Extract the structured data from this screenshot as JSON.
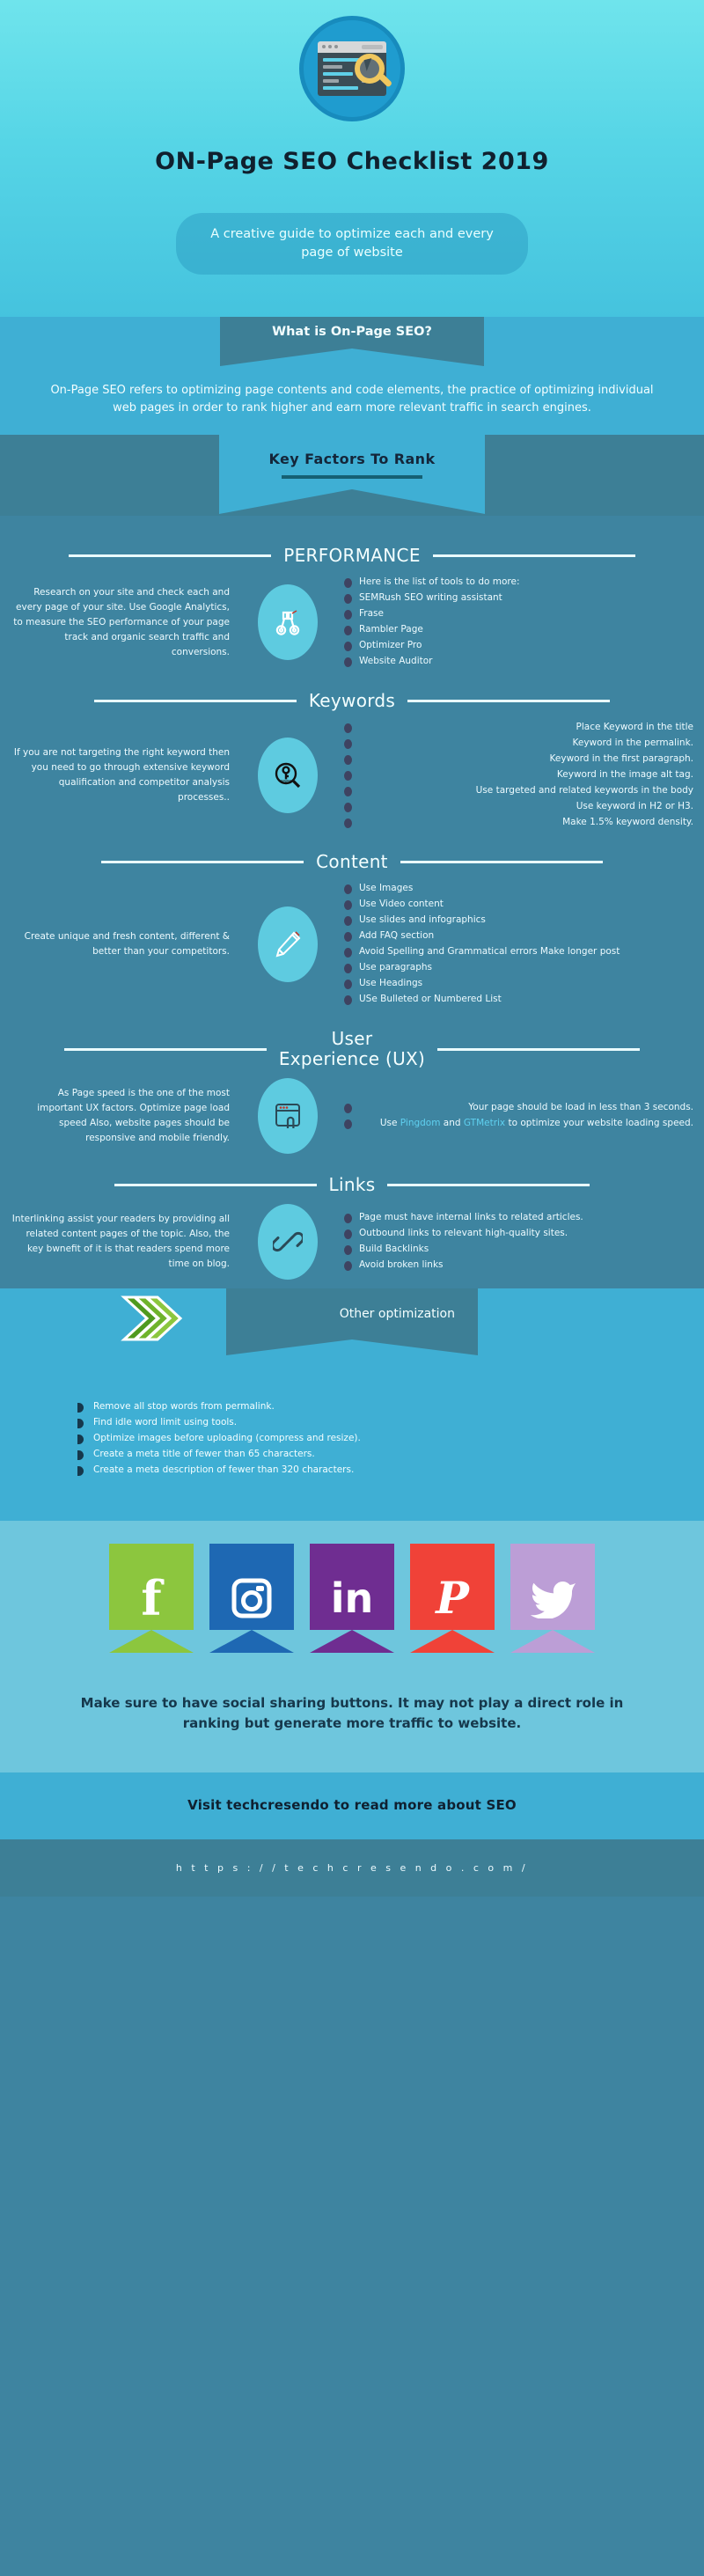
{
  "hero": {
    "icon_name": "seo-search-browser-icon",
    "title": "ON-Page SEO Checklist 2019",
    "subtitle": "A creative guide to optimize each and every page of website"
  },
  "intro": {
    "tab_label": "What is On-Page SEO?",
    "body": "On-Page SEO refers to optimizing page contents and code elements, the practice of optimizing individual web pages in order to rank higher and earn more relevant traffic in search engines.",
    "key_factors_label": "Key Factors To Rank"
  },
  "sections": [
    {
      "id": "performance",
      "title": "PERFORMANCE",
      "icon_name": "binoculars-icon",
      "left_text": "Research on your site and check each and every page of your site. Use Google Analytics, to measure the SEO performance of your page track and organic search traffic and conversions.",
      "bullets": [
        "Here is the list of tools to do more:",
        "SEMRush SEO writing assistant",
        "Frase",
        "Rambler Page",
        "Optimizer Pro",
        "Website Auditor"
      ],
      "bullets_align": "left"
    },
    {
      "id": "keywords",
      "title": "Keywords",
      "icon_name": "magnifier-key-icon",
      "left_text": "If you are not targeting the right keyword then you need to go through extensive keyword qualification and competitor analysis processes..",
      "bullets": [
        "Place Keyword in the title",
        "Keyword in the permalink.",
        "Keyword in the first paragraph.",
        "Keyword in the image alt tag.",
        "Use targeted and related keywords in the body",
        "Use keyword in H2 or H3.",
        "Make 1.5% keyword density."
      ],
      "bullets_align": "right"
    },
    {
      "id": "content",
      "title": "Content",
      "icon_name": "pencil-icon",
      "left_text": "Create unique and fresh content, different & better than your competitors.",
      "bullets": [
        "Use Images",
        "Use Video content",
        "Use slides and infographics",
        "Add FAQ section",
        "Avoid Spelling and Grammatical errors Make longer post",
        "Use paragraphs",
        "Use Headings",
        "USe Bulleted or Numbered List"
      ],
      "bullets_align": "left"
    },
    {
      "id": "ux",
      "title": "User\nExperience (UX)",
      "icon_name": "browser-touch-icon",
      "left_text": "As Page speed is the one of the most important UX factors. Optimize page load speed Also, website pages should be responsive and mobile friendly.",
      "bullets": [
        "Your page should be load in less than 3 seconds.",
        "Use Pingdom and GTMetrix to optimize your website loading speed."
      ],
      "bullets_align": "right",
      "link_words": [
        "Pingdom",
        "GTMetrix"
      ]
    },
    {
      "id": "links",
      "title": "Links",
      "icon_name": "chain-link-icon",
      "left_text": "Interlinking assist your readers by providing all related content pages of the topic. Also, the key bwnefit of it is that readers spend more time on blog.",
      "bullets": [
        "Page must have internal links to related articles.",
        "Outbound links to relevant high-quality sites.",
        "Build Backlinks",
        "Avoid broken links"
      ],
      "bullets_align": "left"
    }
  ],
  "other": {
    "tab_label": "Other\noptimization",
    "chevron_icon_name": "triple-chevron-icon",
    "bullets": [
      "Remove all stop words from permalink.",
      "Find idle word limit using tools.",
      "Optimize images before uploading (compress and resize).",
      "Create a meta title of fewer than 65 characters.",
      "Create a meta description of fewer than 320 characters."
    ]
  },
  "social": {
    "items": [
      {
        "name": "facebook",
        "glyph": "f",
        "color": "#8CC63E"
      },
      {
        "name": "instagram",
        "glyph": "▣",
        "color": "#1E68B3"
      },
      {
        "name": "linkedin",
        "glyph": "in",
        "color": "#6F2D91"
      },
      {
        "name": "pinterest",
        "glyph": "P",
        "color": "#F04238"
      },
      {
        "name": "twitter",
        "glyph": "ὂ6",
        "color": "#BC9ED6"
      }
    ],
    "note": "Make sure to have social sharing buttons. It may not play a direct role in ranking but generate more traffic to website."
  },
  "footer": {
    "cta": "Visit techcresendo to read more about SEO",
    "url": "h t t p s : / / t e c h c r e s e n d o . c o m /"
  },
  "colors": {
    "hero_top": "#6FE4EC",
    "band_light": "#3FAFD4",
    "band_dark": "#3E84A0",
    "tab_dark": "#3D7F96",
    "oval": "#5ECBE0",
    "bullet": "#3E4361",
    "social_band": "#6EC6DD",
    "link": "#5FD0F0"
  }
}
